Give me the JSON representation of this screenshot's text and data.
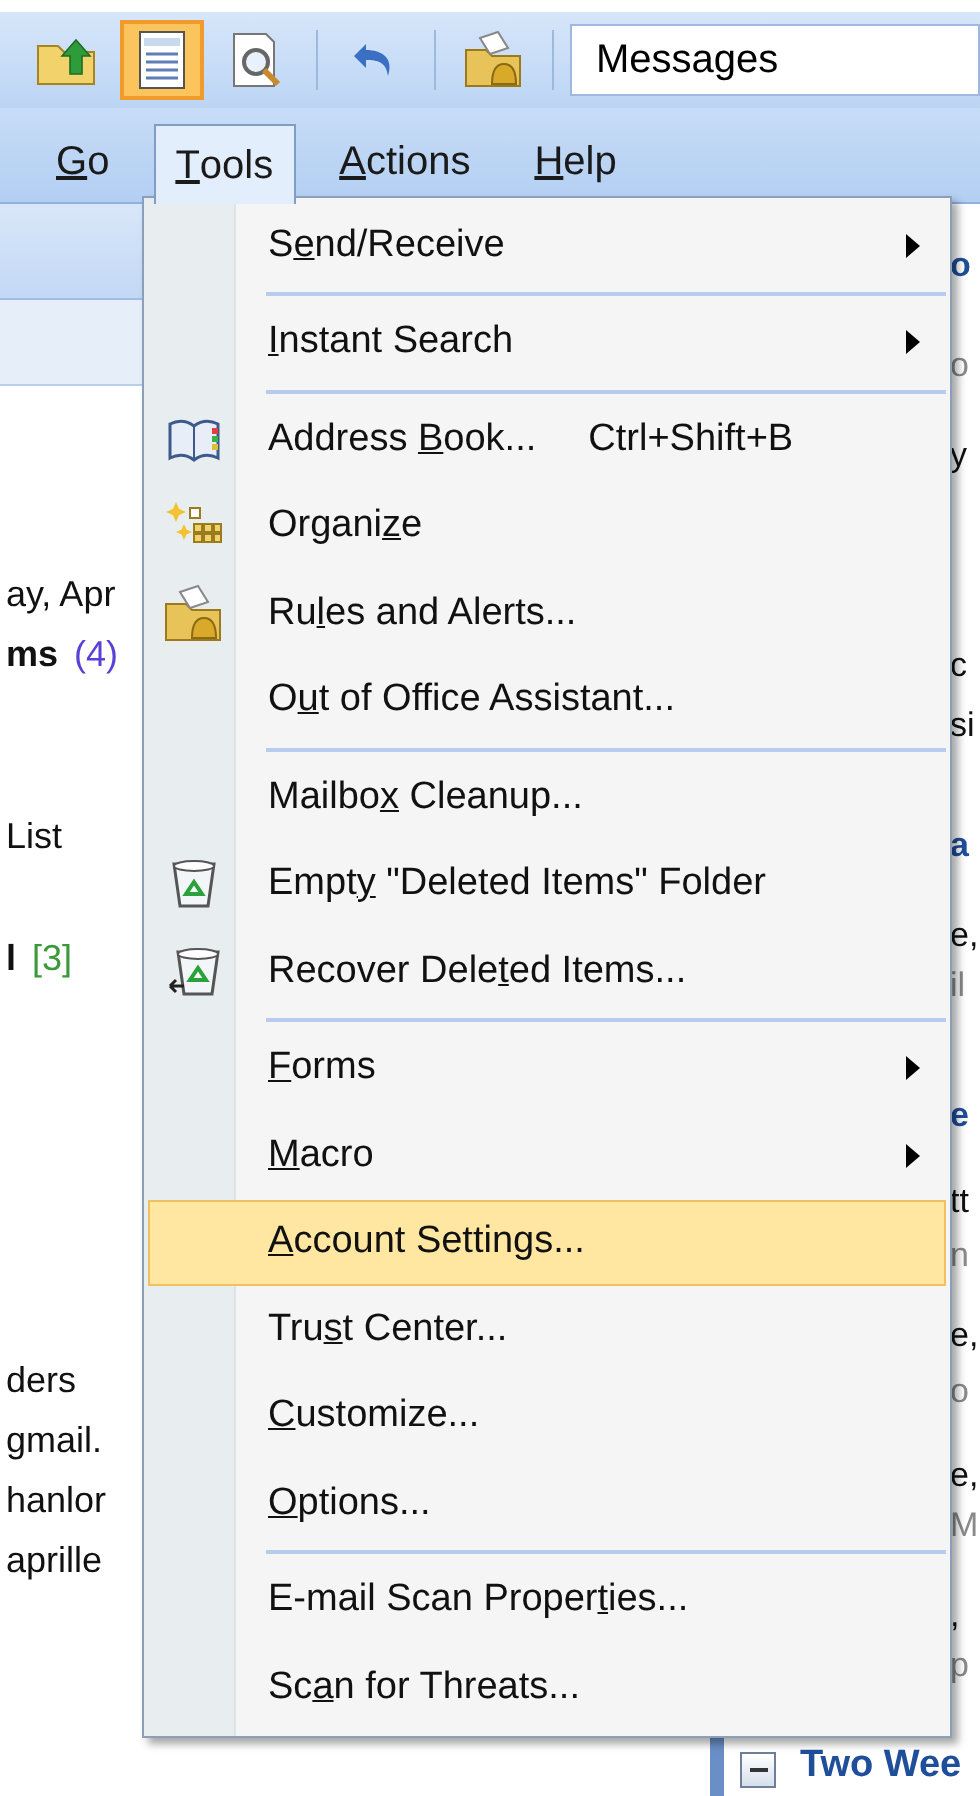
{
  "toolbar": {
    "buttons": [
      {
        "kind": "folderup",
        "selected": false
      },
      {
        "kind": "list",
        "selected": true
      },
      {
        "kind": "preview",
        "selected": false
      },
      {
        "kind": "separator"
      },
      {
        "kind": "undo",
        "selected": false
      },
      {
        "kind": "separator"
      },
      {
        "kind": "rules",
        "selected": false
      },
      {
        "kind": "separator"
      }
    ],
    "view_field": {
      "value": "Messages"
    }
  },
  "menubar": [
    {
      "key": "G",
      "after": "o",
      "selected": false
    },
    {
      "key": "T",
      "after": "ools",
      "selected": true
    },
    {
      "key": "A",
      "after": "ctions",
      "selected": false
    },
    {
      "key": "H",
      "after": "elp",
      "selected": false
    }
  ],
  "menu": [
    {
      "kind": "plain",
      "before": "S",
      "key": "e",
      "after": "nd/Receive",
      "submenu": true,
      "highlighted": false
    },
    {
      "kind": "separator"
    },
    {
      "kind": "plain",
      "key": "I",
      "after": "nstant Search",
      "submenu": true,
      "highlighted": false
    },
    {
      "kind": "separator"
    },
    {
      "kind": "book",
      "before": "Address ",
      "key": "B",
      "after": "ook...",
      "shortcut": "Ctrl+Shift+B",
      "submenu": false,
      "highlighted": false
    },
    {
      "kind": "organize",
      "before": "Organi",
      "key": "z",
      "after": "e",
      "submenu": false,
      "highlighted": false
    },
    {
      "kind": "rules",
      "before": "Ru",
      "key": "l",
      "after": "es and Alerts...",
      "submenu": false,
      "highlighted": false
    },
    {
      "kind": "plain",
      "before": "O",
      "key": "u",
      "after": "t of Office Assistant...",
      "submenu": false,
      "highlighted": false
    },
    {
      "kind": "separator"
    },
    {
      "kind": "plain",
      "before": "Mailbo",
      "key": "x",
      "after": " Cleanup...",
      "submenu": false,
      "highlighted": false
    },
    {
      "kind": "trash",
      "before": "Empt",
      "key": "y",
      "after": " \"Deleted Items\" Folder",
      "submenu": false,
      "highlighted": false
    },
    {
      "kind": "restore",
      "before": "Recover Dele",
      "key": "t",
      "after": "ed Items...",
      "submenu": false,
      "highlighted": false
    },
    {
      "kind": "separator"
    },
    {
      "kind": "plain",
      "key": "F",
      "after": "orms",
      "submenu": true,
      "highlighted": false
    },
    {
      "kind": "plain",
      "key": "M",
      "after": "acro",
      "submenu": true,
      "highlighted": false
    },
    {
      "kind": "plain",
      "key": "A",
      "after": "ccount Settings...",
      "submenu": false,
      "highlighted": true
    },
    {
      "kind": "plain",
      "before": "Tru",
      "key": "s",
      "after": "t Center...",
      "submenu": false,
      "highlighted": false
    },
    {
      "kind": "plain",
      "key": "C",
      "after": "ustomize...",
      "submenu": false,
      "highlighted": false
    },
    {
      "kind": "plain",
      "key": "O",
      "after": "ptions...",
      "submenu": false,
      "highlighted": false
    },
    {
      "kind": "separator"
    },
    {
      "kind": "plain",
      "before": "E-mail Scan Proper",
      "key": "t",
      "after": "ies...",
      "submenu": false,
      "highlighted": false
    },
    {
      "kind": "plain",
      "before": "Sc",
      "key": "a",
      "after": "n for Threats...",
      "submenu": false,
      "highlighted": false
    }
  ],
  "left_pane": [
    {
      "text": "ay, Apr",
      "bold": false
    },
    {
      "text": "ms",
      "bold": true,
      "count": "(4)",
      "color": "#5b3fd6"
    },
    {
      "text": "List",
      "bold": false
    },
    {
      "text": "l",
      "bold": true,
      "count": "[3]",
      "color": "#3a9a3a"
    },
    {
      "text": "ders",
      "bold": false
    },
    {
      "text": "gmail.",
      "bold": false
    },
    {
      "text": "hanlor",
      "bold": false
    },
    {
      "text": "aprille",
      "bold": false
    }
  ],
  "right_pane": [
    {
      "kind": "heading",
      "text": "o"
    },
    {
      "kind": "muted",
      "text": "o"
    },
    {
      "kind": "text",
      "text": "y"
    },
    {
      "kind": "text",
      "text": "c"
    },
    {
      "kind": "text",
      "text": "si"
    },
    {
      "kind": "heading",
      "text": "a"
    },
    {
      "kind": "text",
      "text": "e,"
    },
    {
      "kind": "muted",
      "text": "il"
    },
    {
      "kind": "heading",
      "text": "e"
    },
    {
      "kind": "text",
      "text": "tt"
    },
    {
      "kind": "muted",
      "text": "n"
    },
    {
      "kind": "text",
      "text": "e,"
    },
    {
      "kind": "muted",
      "text": "o"
    },
    {
      "kind": "text",
      "text": "e,"
    },
    {
      "kind": "muted",
      "text": "M"
    },
    {
      "kind": "text",
      "text": ","
    },
    {
      "kind": "muted",
      "text": "p"
    }
  ],
  "group_header": {
    "text": "Two Wee",
    "expanded": true
  }
}
